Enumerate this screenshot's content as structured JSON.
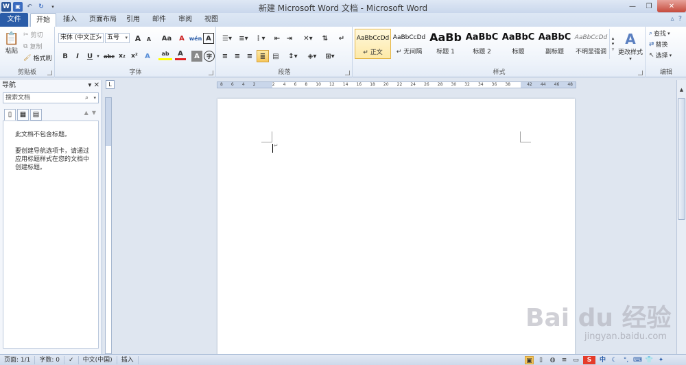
{
  "window": {
    "title": "新建 Microsoft Word 文档 - Microsoft Word",
    "controls": {
      "minimize": "—",
      "restore": "❐",
      "close": "✕"
    }
  },
  "qat": {
    "word_icon": "W",
    "save_icon": "save-icon",
    "undo_icon": "undo-icon",
    "redo_icon": "redo-icon"
  },
  "tabs": {
    "file": "文件",
    "items": [
      "开始",
      "插入",
      "页面布局",
      "引用",
      "邮件",
      "审阅",
      "视图"
    ],
    "active": "开始"
  },
  "ribbon": {
    "clipboard": {
      "label": "剪贴板",
      "paste": "粘贴",
      "cut": "剪切",
      "copy": "复制",
      "format_painter": "格式刷"
    },
    "font": {
      "label": "字体",
      "font_name": "宋体 (中文正文)",
      "font_size": "五号",
      "grow": "A",
      "shrink": "A",
      "case": "Aa",
      "clear": "A",
      "wen": "wén",
      "char_border": "A",
      "bold": "B",
      "italic": "I",
      "underline": "U",
      "strike": "abc",
      "subscript": "x₂",
      "superscript": "x²",
      "text_effect": "A",
      "highlight": "ab",
      "font_color": "A",
      "char_shade": "A",
      "enclose": "字"
    },
    "paragraph": {
      "label": "段落"
    },
    "styles": {
      "label": "样式",
      "items": [
        {
          "preview": "AaBbCcDd",
          "name": "↵ 正文"
        },
        {
          "preview": "AaBbCcDd",
          "name": "↵ 无间隔"
        },
        {
          "preview": "AaBb",
          "name": "标题 1"
        },
        {
          "preview": "AaBbC",
          "name": "标题 2"
        },
        {
          "preview": "AaBbC",
          "name": "标题"
        },
        {
          "preview": "AaBbC",
          "name": "副标题"
        },
        {
          "preview": "AaBbCcDd",
          "name": "不明显强调"
        }
      ],
      "change_styles": "更改样式"
    },
    "editing": {
      "label": "编辑",
      "find": "查找",
      "replace": "替换",
      "select": "选择"
    }
  },
  "nav": {
    "title": "导航",
    "search_placeholder": "搜索文档",
    "message1": "此文档不包含标题。",
    "message2": "要创建导航选项卡，请通过应用标题样式在您的文档中创建标题。"
  },
  "ruler": {
    "box": "L",
    "ticks": [
      "8",
      "6",
      "4",
      "2",
      "",
      "2",
      "4",
      "6",
      "8",
      "10",
      "12",
      "14",
      "16",
      "18",
      "20",
      "22",
      "24",
      "26",
      "28",
      "30",
      "32",
      "34",
      "36",
      "38",
      "",
      "42",
      "44",
      "46",
      "48"
    ]
  },
  "document": {
    "paragraph_mark": "↵"
  },
  "status": {
    "page": "页面: 1/1",
    "words": "字数: 0",
    "lang": "中文(中国)",
    "mode": "插入"
  },
  "watermark": {
    "logo": "Bai du 经验",
    "sub": "jingyan.baidu.com"
  },
  "colors": {
    "file_tab": "#2a5ca8",
    "accent": "#e3b446",
    "font_color_bar": "#e02020",
    "highlight_bar": "#ffff00"
  }
}
